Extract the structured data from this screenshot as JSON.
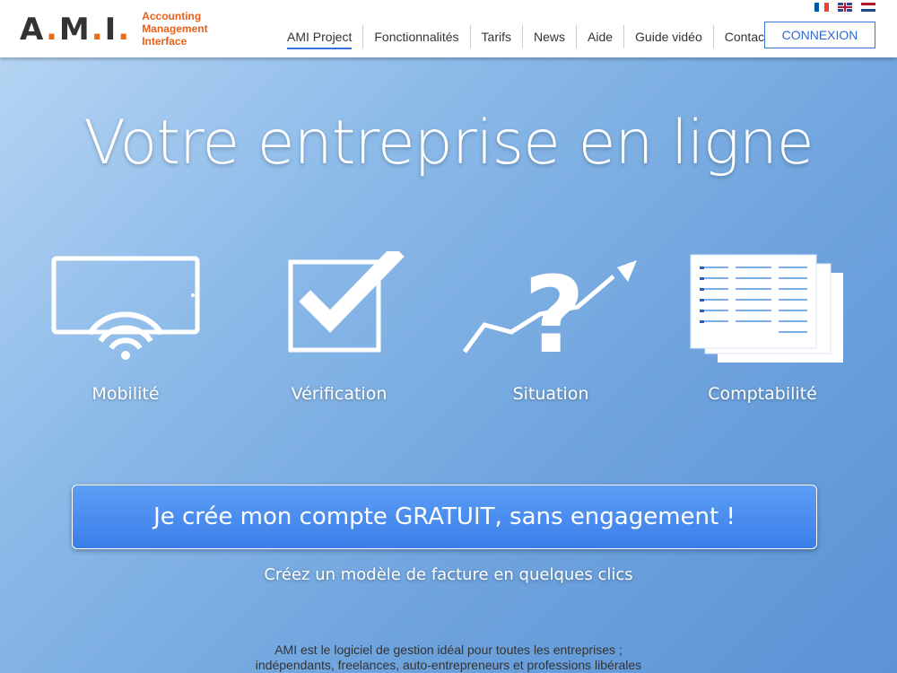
{
  "header": {
    "logo_text": "A.M.I.",
    "logo_sub": [
      "Accounting",
      "Management",
      "Interface"
    ],
    "nav": [
      {
        "label": "AMI Project",
        "active": true
      },
      {
        "label": "Fonctionnalités"
      },
      {
        "label": "Tarifs"
      },
      {
        "label": "News"
      },
      {
        "label": "Aide"
      },
      {
        "label": "Guide vidéo"
      },
      {
        "label": "Contact"
      }
    ],
    "login_label": "CONNEXION",
    "languages": [
      "fr-flag-icon",
      "uk-flag-icon",
      "nl-flag-icon"
    ]
  },
  "hero": {
    "title": "Votre entreprise en ligne",
    "features": [
      {
        "label": "Mobilité",
        "icon": "tablet-wifi-icon"
      },
      {
        "label": "Vérification",
        "icon": "checkbox-check-icon"
      },
      {
        "label": "Situation",
        "icon": "chart-question-icon"
      },
      {
        "label": "Comptabilité",
        "icon": "spreadsheet-icon"
      }
    ],
    "cta_label": "Je crée mon compte GRATUIT, sans engagement !",
    "cta_sub": "Créez un modèle de facture en quelques clics",
    "description": [
      "AMI est le logiciel de gestion idéal pour toutes les entreprises ;",
      "indépendants, freelances, auto-entrepreneurs et professions libérales"
    ]
  },
  "colors": {
    "brand_orange": "#e8601a",
    "accent_blue": "#3a73d6",
    "cta_blue": "#4a8cef"
  }
}
